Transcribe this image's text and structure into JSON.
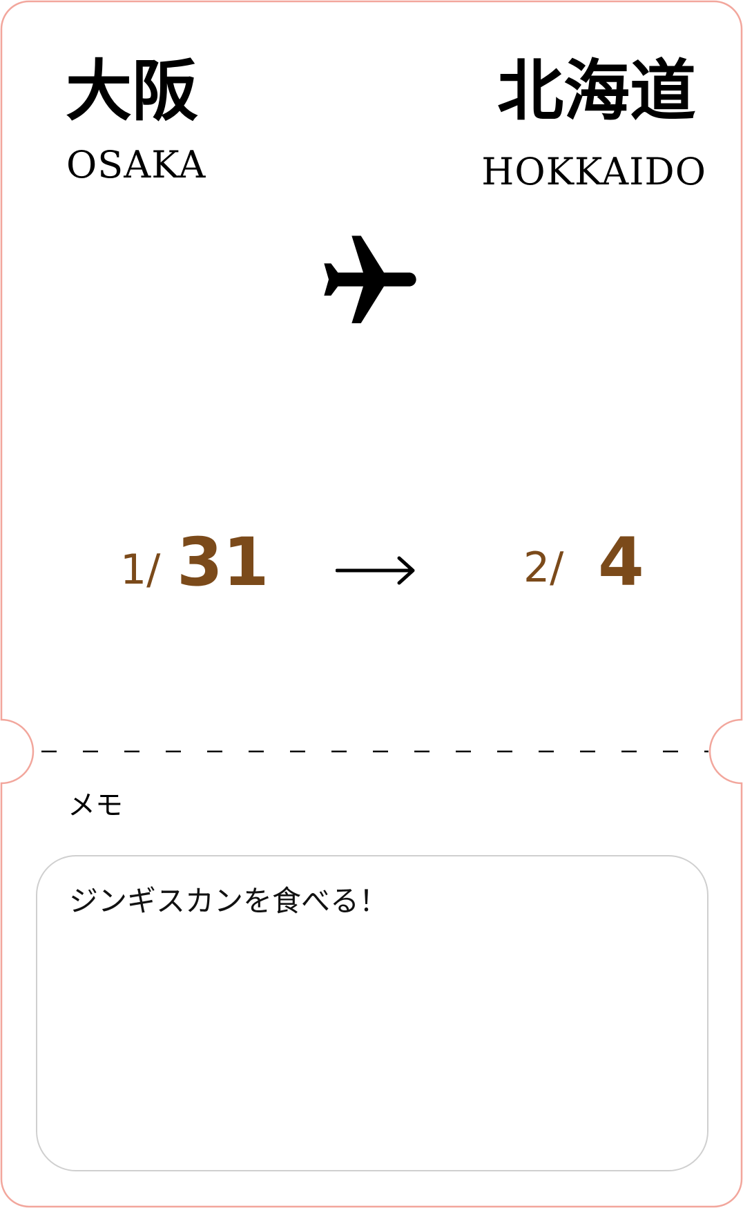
{
  "ticket": {
    "origin": {
      "name_jp": "大阪",
      "name_en": "OSAKA"
    },
    "destination": {
      "name_jp": "北海道",
      "name_en": "HOKKAIDO"
    },
    "transport_icon": "airplane-icon",
    "departure": {
      "month": "1/",
      "day": "31"
    },
    "return": {
      "month": "2/",
      "day": "4"
    },
    "date_separator_icon": "right-arrow-icon",
    "memo": {
      "label": "メモ",
      "value": "ジンギスカンを食べる！"
    }
  },
  "colors": {
    "outline": "#f2a69c",
    "date_text": "#7b4a1a",
    "memo_border": "#cfcfcf",
    "divider": "#000000"
  }
}
